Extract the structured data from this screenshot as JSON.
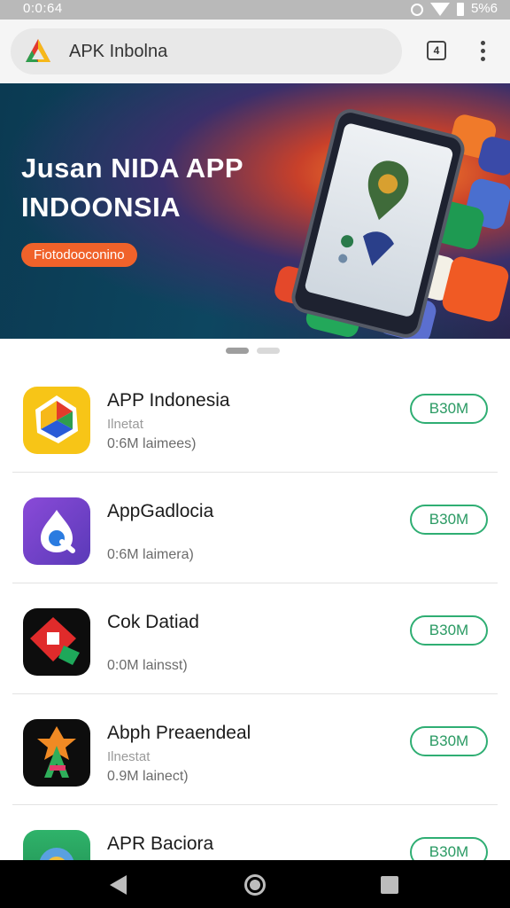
{
  "status_bar": {
    "time": "0:0:64",
    "right_text": "5%6"
  },
  "browser": {
    "url": "APK Inbolna",
    "tab_count": "4"
  },
  "banner": {
    "title_line1": "Jusan NIDA APP",
    "title_line2": "INDOONSIA",
    "cta_label": "Fiotodooconino"
  },
  "apps": [
    {
      "name": "APP Indonesia",
      "subtitle": "Ilnetat",
      "meta": "0:6M laimees)",
      "button": "B30M"
    },
    {
      "name": "AppGadlocia",
      "subtitle": "",
      "meta": "0:6M laimera)",
      "button": "B30M"
    },
    {
      "name": "Cok Datiad",
      "subtitle": "",
      "meta": "0:0M lainsst)",
      "button": "B30M"
    },
    {
      "name": "Abph Preaendeal",
      "subtitle": "Ilnestat",
      "meta": "0.9M lainect)",
      "button": "B30M"
    },
    {
      "name": "APR Baciora",
      "subtitle": "",
      "meta": "",
      "button": "B30M"
    }
  ],
  "icons": {
    "status": [
      "alarm-icon",
      "wifi-icon",
      "battery-icon"
    ],
    "nav": [
      "back-icon",
      "home-icon",
      "recent-apps-icon"
    ]
  },
  "colors": {
    "accent_green": "#2fae73",
    "cta_orange": "#f0622a",
    "banner_dark": "#0d4660"
  }
}
